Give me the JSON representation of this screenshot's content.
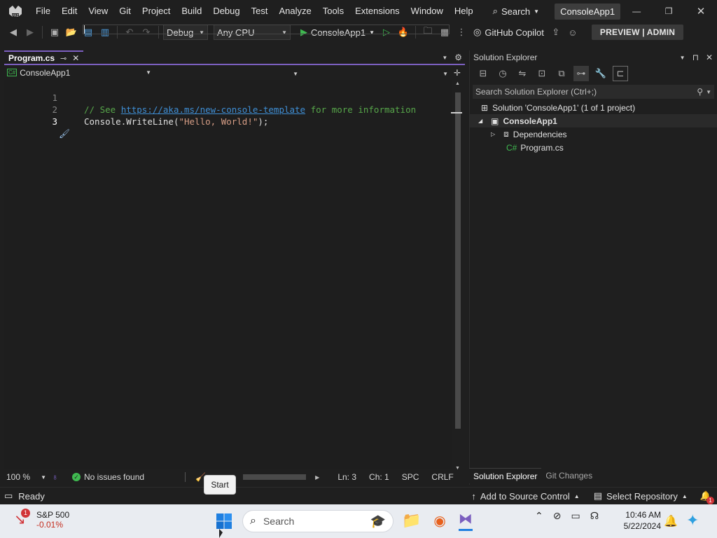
{
  "titlebar": {
    "menu": [
      "File",
      "Edit",
      "View",
      "Git",
      "Project",
      "Build",
      "Debug",
      "Test",
      "Analyze",
      "Tools",
      "Extensions",
      "Window",
      "Help"
    ],
    "search_label": "Search",
    "project_badge": "ConsoleApp1"
  },
  "toolbar": {
    "config": "Debug",
    "platform": "Any CPU",
    "run_target": "ConsoleApp1",
    "copilot": "GitHub Copilot",
    "preview_badge": "PREVIEW | ADMIN"
  },
  "editor": {
    "tab_label": "Program.cs",
    "nav_project": "ConsoleApp1",
    "line_numbers": [
      "1",
      "2",
      "3"
    ],
    "line1": {
      "prefix": "// See ",
      "link": "https://aka.ms/new-console-template",
      "suffix": " for more information"
    },
    "line2": {
      "cls": "Console",
      "dot": ".",
      "method": "WriteLine",
      "open": "(",
      "str": "\"Hello, World!\"",
      "close": ");"
    },
    "zoom": "100 %",
    "issues": "No issues found",
    "ln": "Ln: 3",
    "ch": "Ch: 1",
    "spc": "SPC",
    "crlf": "CRLF"
  },
  "solution_explorer": {
    "title": "Solution Explorer",
    "search_placeholder": "Search Solution Explorer (Ctrl+;)",
    "solution": "Solution 'ConsoleApp1' (1 of 1 project)",
    "project": "ConsoleApp1",
    "dependencies": "Dependencies",
    "file": "Program.cs",
    "tab_solution": "Solution Explorer",
    "tab_git": "Git Changes"
  },
  "statusbar": {
    "ready": "Ready",
    "add_source": "Add to Source Control",
    "select_repo": "Select Repository",
    "notification_count": "1"
  },
  "tooltip": {
    "start": "Start"
  },
  "taskbar": {
    "stock_name": "S&P 500",
    "stock_change": "-0.01%",
    "stock_badge": "1",
    "search": "Search",
    "time": "10:46 AM",
    "date": "5/22/2024"
  },
  "colors": {
    "accent": "#7b5fbf",
    "run_green": "#3fb950",
    "comment": "#57a64a",
    "link": "#3f8fd6",
    "string": "#d69d85"
  }
}
